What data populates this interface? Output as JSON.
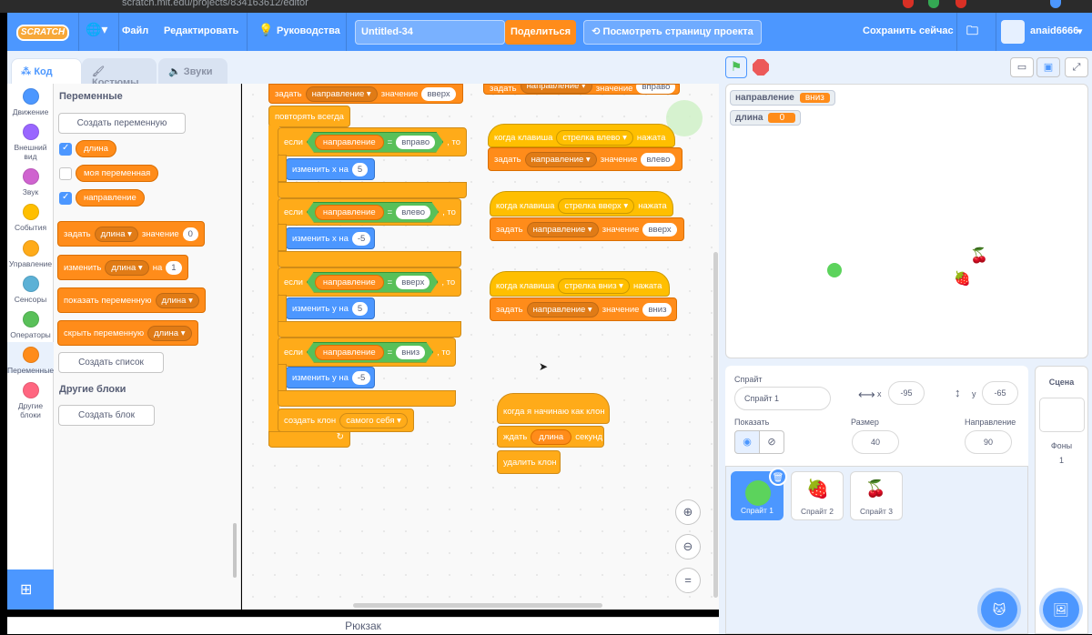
{
  "browser": {
    "url": "scratch.mit.edu/projects/834163612/editor"
  },
  "menu": {
    "logo": "SCRATCH",
    "file": "Файл",
    "edit": "Редактировать",
    "tutorials": "Руководства",
    "title": "Untitled-34",
    "share": "Поделиться",
    "see_project": "Посмотреть страницу проекта",
    "save_now": "Сохранить сейчас",
    "username": "anaid6666"
  },
  "tabs": {
    "code": "Код",
    "costumes": "Костюмы",
    "sounds": "Звуки"
  },
  "categories": [
    {
      "label": "Движение",
      "color": "#4c97ff"
    },
    {
      "label": "Внешний вид",
      "color": "#9966ff"
    },
    {
      "label": "Звук",
      "color": "#cf63cf"
    },
    {
      "label": "События",
      "color": "#ffbf00"
    },
    {
      "label": "Управление",
      "color": "#ffab19"
    },
    {
      "label": "Сенсоры",
      "color": "#5cb1d6"
    },
    {
      "label": "Операторы",
      "color": "#59c059"
    },
    {
      "label": "Переменные",
      "color": "#ff8c1a"
    },
    {
      "label": "Другие блоки",
      "color": "#ff6680"
    }
  ],
  "palette": {
    "variables_header": "Переменные",
    "make_variable": "Создать переменную",
    "vars": [
      {
        "name": "длина",
        "checked": true
      },
      {
        "name": "моя переменная",
        "checked": false
      },
      {
        "name": "направление",
        "checked": true
      }
    ],
    "set_block": {
      "a": "задать",
      "var": "длина",
      "b": "значение",
      "val": "0"
    },
    "change_block": {
      "a": "изменить",
      "var": "длина",
      "b": "на",
      "val": "1"
    },
    "show_block": {
      "a": "показать переменную",
      "var": "длина"
    },
    "hide_block": {
      "a": "скрыть переменную",
      "var": "длина"
    },
    "make_list": "Создать список",
    "more_header": "Другие блоки",
    "make_block": "Создать блок"
  },
  "script": {
    "top_set": {
      "a": "задать",
      "var": "направление",
      "b": "значение",
      "val": "вверх"
    },
    "forever": "повторять всегда",
    "ifs": [
      {
        "if": "если",
        "var": "направление",
        "eq": "=",
        "val": "вправо",
        "then": ", то",
        "change": "изменить x на",
        "n": "5"
      },
      {
        "if": "если",
        "var": "направление",
        "eq": "=",
        "val": "влево",
        "then": ", то",
        "change": "изменить x на",
        "n": "-5"
      },
      {
        "if": "если",
        "var": "направление",
        "eq": "=",
        "val": "вверх",
        "then": ", то",
        "change": "изменить у на",
        "n": "5"
      },
      {
        "if": "если",
        "var": "направление",
        "eq": "=",
        "val": "вниз",
        "then": ", то",
        "change": "изменить у на",
        "n": "-5"
      }
    ],
    "clone": {
      "a": "создать клон",
      "opt": "самого себя"
    },
    "right_top": {
      "a": "задать",
      "var": "направление",
      "b": "значение",
      "val": "вправо"
    },
    "key_left": {
      "when": "когда клавиша",
      "key": "стрелка влево",
      "pressed": "нажата",
      "set": "задать",
      "var": "направление",
      "b": "значение",
      "val": "влево"
    },
    "key_up": {
      "when": "когда клавиша",
      "key": "стрелка вверх",
      "pressed": "нажата",
      "set": "задать",
      "var": "направление",
      "b": "значение",
      "val": "вверх"
    },
    "key_down": {
      "when": "когда клавиша",
      "key": "стрелка вниз",
      "pressed": "нажата",
      "set": "задать",
      "var": "направление",
      "b": "значение",
      "val": "вниз"
    },
    "clone_hat": {
      "when": "когда я начинаю как клон",
      "wait": "ждать",
      "var": "длина",
      "sec": "секунд",
      "del": "удалить клон"
    }
  },
  "backpack": "Рюкзак",
  "monitors": [
    {
      "name": "направление",
      "value": "вниз"
    },
    {
      "name": "длина",
      "value": "0"
    }
  ],
  "sprite_info": {
    "sprite_label": "Спрайт",
    "sprite_name": "Спрайт 1",
    "x_label": "x",
    "x": "-95",
    "y_label": "y",
    "y": "-65",
    "show_label": "Показать",
    "size_label": "Размер",
    "size": "40",
    "dir_label": "Направление",
    "dir": "90"
  },
  "sprites": [
    {
      "name": "Спрайт 1",
      "selected": true
    },
    {
      "name": "Спрайт 2",
      "selected": false
    },
    {
      "name": "Спрайт 3",
      "selected": false
    }
  ],
  "scene": {
    "label": "Сцена",
    "backdrops_label": "Фоны",
    "backdrops_count": "1"
  },
  "colors": {
    "blue": "#4c97ff",
    "orange": "#ff8c1a",
    "control": "#ffab19",
    "events": "#ffbf00",
    "operators": "#59c059"
  }
}
